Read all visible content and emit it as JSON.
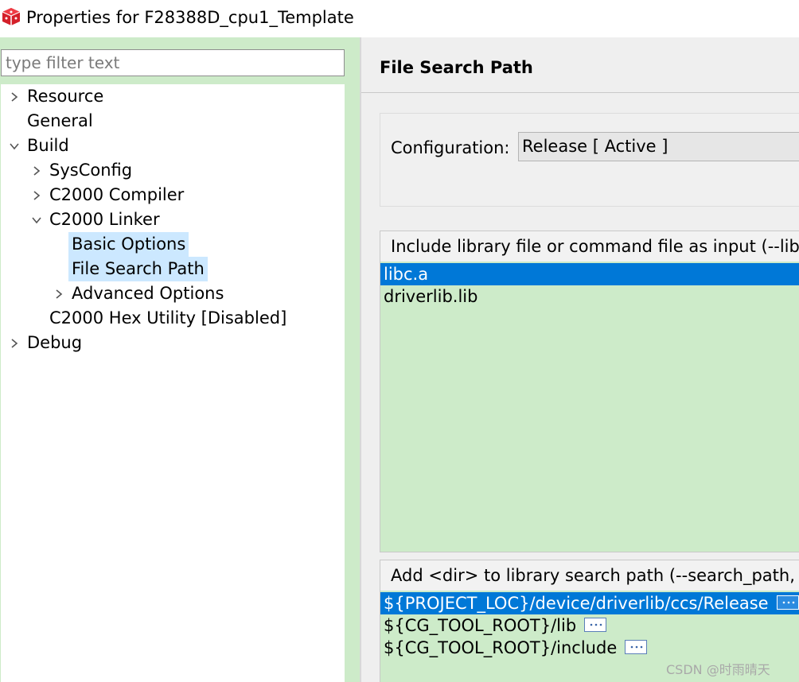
{
  "window": {
    "title": "Properties for F28388D_cpu1_Template"
  },
  "filter": {
    "placeholder": "type filter text",
    "value": ""
  },
  "tree": {
    "resource": "Resource",
    "general": "General",
    "build": "Build",
    "sysconfig": "SysConfig",
    "compiler": "C2000 Compiler",
    "linker": "C2000 Linker",
    "basic_options": "Basic Options",
    "file_search_path": "File Search Path",
    "advanced_options": "Advanced Options",
    "hex_utility": "C2000 Hex Utility  [Disabled]",
    "debug": "Debug"
  },
  "page": {
    "title": "File Search Path"
  },
  "configuration": {
    "label": "Configuration:",
    "value": "Release  [ Active ]"
  },
  "library_input": {
    "header": "Include library file or command file as input (--library, -l)",
    "items": [
      "libc.a",
      "driverlib.lib"
    ]
  },
  "search_path": {
    "header": "Add <dir> to library search path (--search_path, -i)",
    "items": [
      "${PROJECT_LOC}/device/driverlib/ccs/Release",
      "${CG_TOOL_ROOT}/lib",
      "${CG_TOOL_ROOT}/include"
    ]
  },
  "watermark": "CSDN @时雨晴天",
  "colors": {
    "selection": "#0078d7",
    "panel_green": "#cdebc9",
    "tree_selected": "#cce8ff"
  },
  "icons": [
    "ccs-red-cube-icon",
    "chevron-right-icon",
    "chevron-down-icon",
    "ellipsis-button-icon"
  ]
}
